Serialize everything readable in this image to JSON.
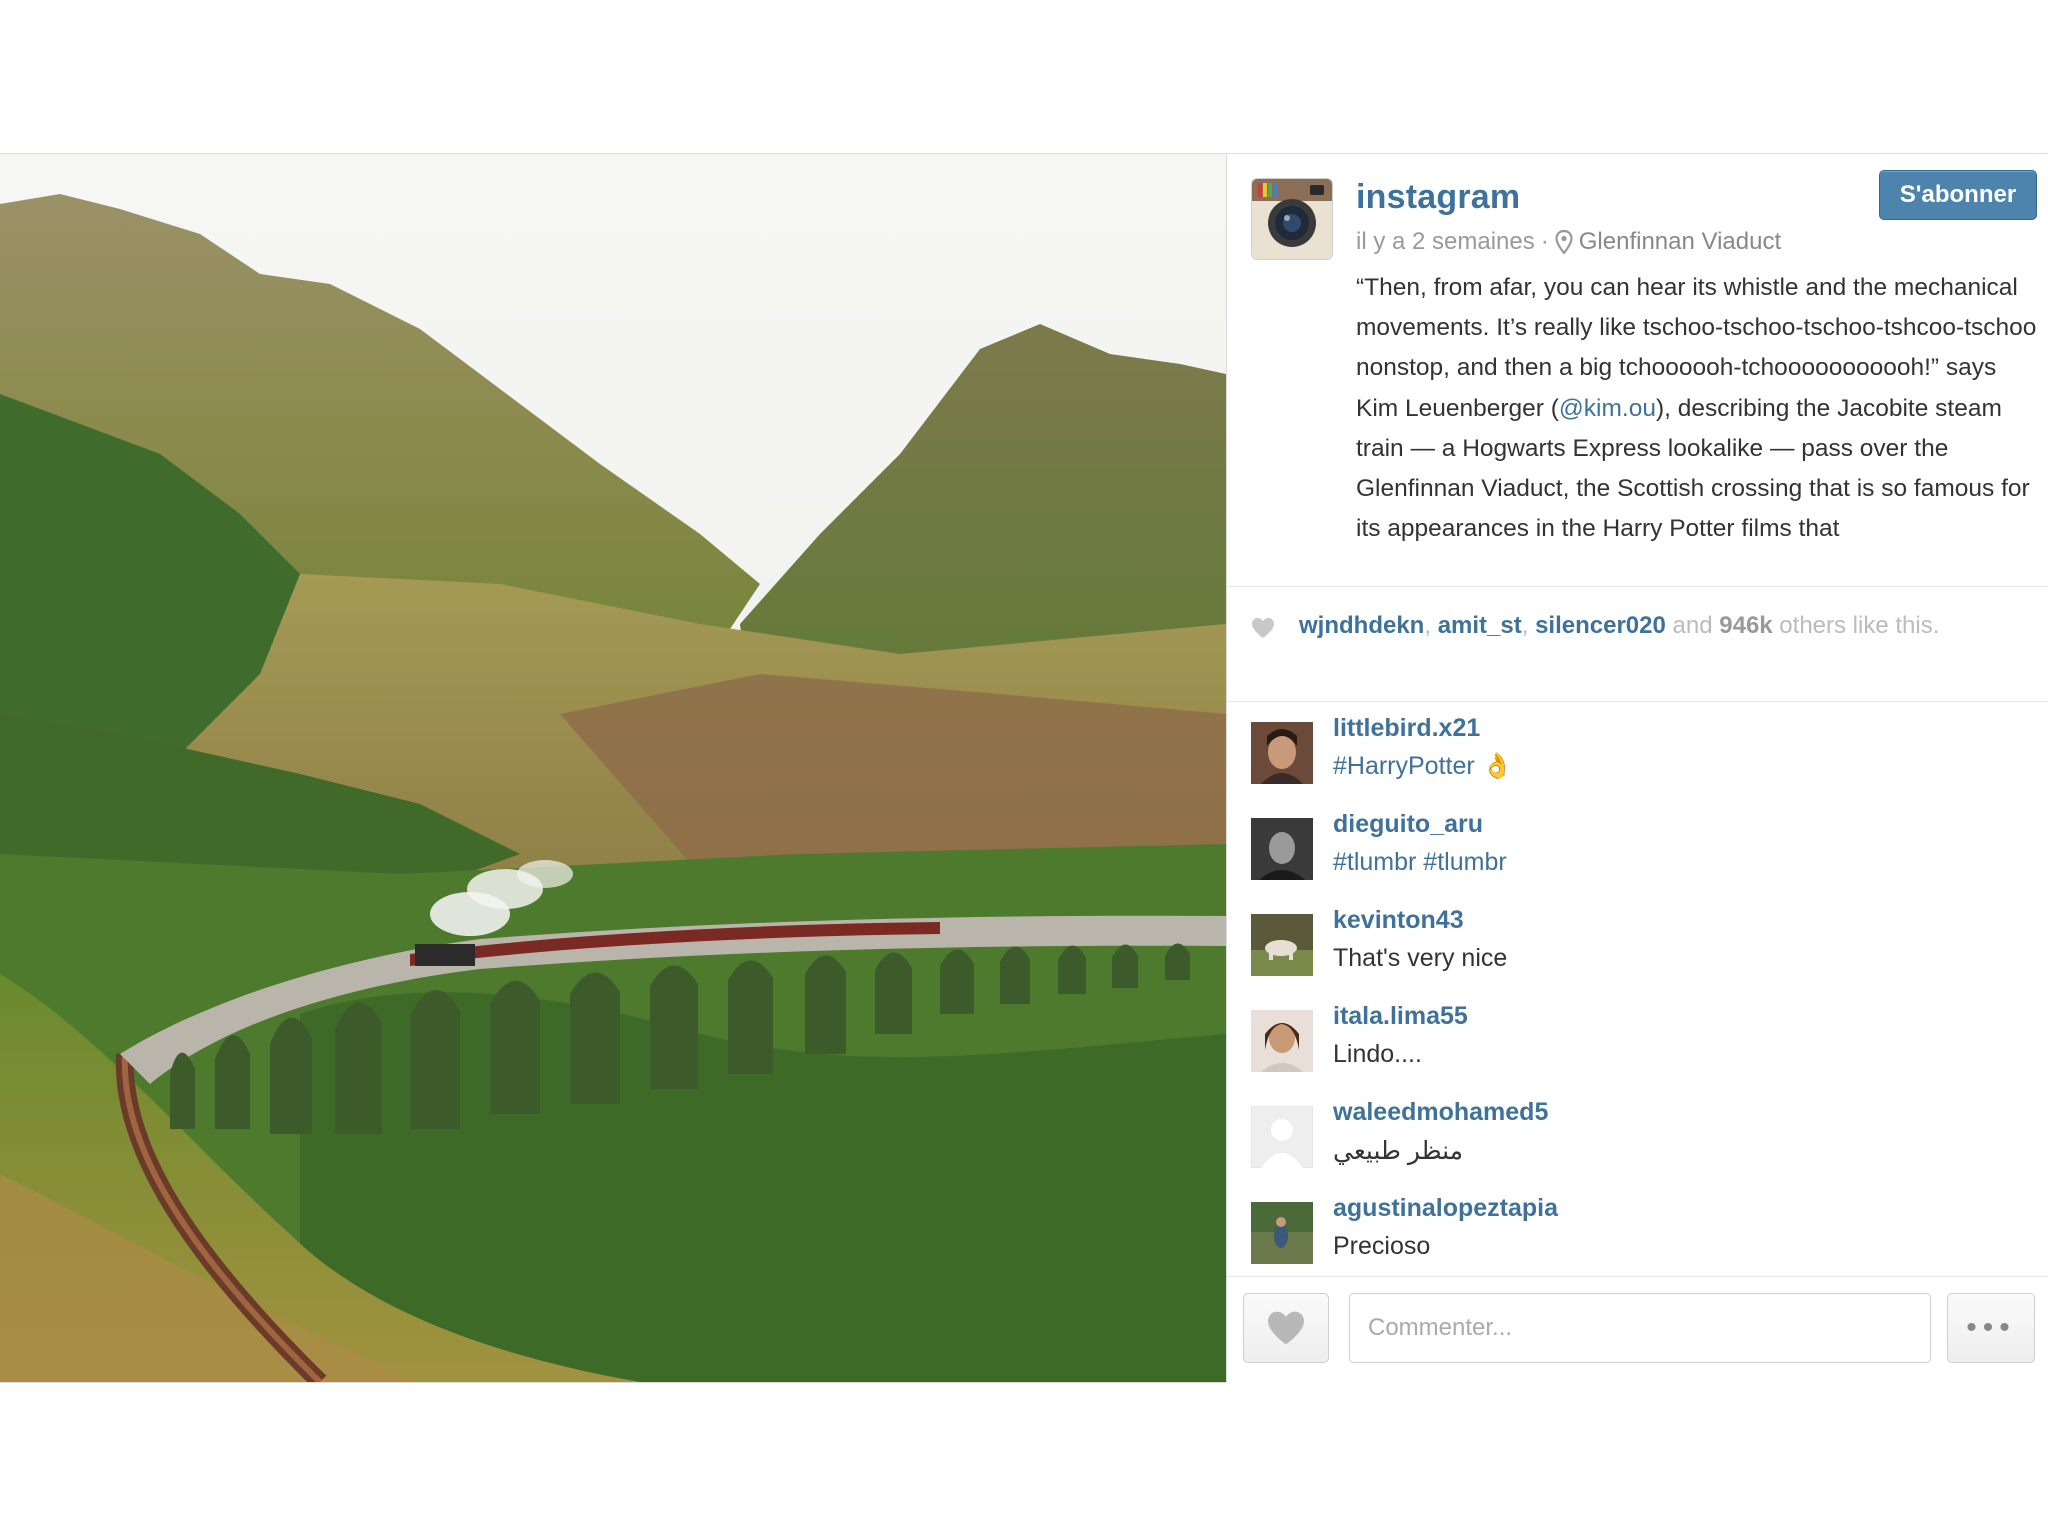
{
  "photo": {
    "description_icon": "landscape-photo",
    "colors": {
      "sky": "#f4f4f2",
      "mountain": "#8f8a55",
      "forest": "#3f6b2c",
      "viaduct": "#b9b5aa",
      "train": "#7a2a22"
    }
  },
  "post": {
    "owner": "instagram",
    "follow_label": "S'abonner",
    "time_ago": "il y a 2 semaines",
    "separator": "·",
    "location_icon": "map-pin-icon",
    "location": "Glenfinnan Viaduct",
    "caption_before": "“Then, from afar, you can hear its whistle and the mechanical movements. It’s really like tschoo-tschoo-tschoo-tshcoo-tschoo nonstop, and then a big tchoooooh-tchooooooooooh!” says Kim Leuenberger (",
    "caption_mention": "@kim.ou",
    "caption_after": "), describing the Jacobite steam train — a Hogwarts Express lookalike — pass over the Glenfinnan Viaduct, the Scottish crossing that is so famous for its appearances in the Harry Potter films that"
  },
  "likes": {
    "icon": "heart-icon",
    "user1": "wjndhdekn",
    "sep1": ", ",
    "user2": "amit_st",
    "sep2": ", ",
    "user3": "silencer020",
    "and": " and ",
    "count": "946k",
    "tail": " others like this."
  },
  "comments": [
    {
      "user": "littlebird.x21",
      "text": "#HarryPotter 👌"
    },
    {
      "user": "dieguito_aru",
      "text": "#tlumbr #tlumbr"
    },
    {
      "user": "kevinton43",
      "text": "That's very nice"
    },
    {
      "user": "itala.lima55",
      "text": "Lindo...."
    },
    {
      "user": "waleedmohamed5",
      "text": "منظر طبيعي"
    },
    {
      "user": "agustinalopeztapia",
      "text": "Precioso"
    }
  ],
  "footer": {
    "comment_placeholder": "Commenter...",
    "more_label": "•••",
    "like_icon": "heart-icon"
  },
  "colors": {
    "accent": "#3f729b",
    "button": "#4d84ad"
  }
}
